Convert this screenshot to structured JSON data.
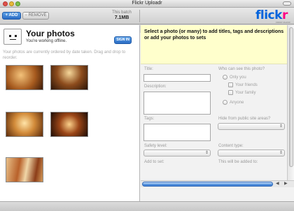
{
  "window": {
    "title": "Flickr Uploadr"
  },
  "toolbar": {
    "add_label": "+ ADD",
    "remove_label": "− REMOVE",
    "batch_label": "This batch",
    "batch_size": "7.1MB"
  },
  "brand": {
    "logo_part1": "flick",
    "logo_part2": "r",
    "logo_sub": "FROM YAHOO!",
    "color_blue": "#0063dc",
    "color_pink": "#ff0084"
  },
  "left_pane": {
    "title": "Your photos",
    "status": "You're working offline.",
    "signin_label": "SIGN IN",
    "order_note": "Your photos are currently ordered by date taken. Drag and drop to reorder.",
    "photos_count": 5
  },
  "right_pane": {
    "banner": "Select a photo (or many) to add titles, tags and descriptions or add your photos to sets",
    "title_label": "Title:",
    "description_label": "Description:",
    "tags_label": "Tags:",
    "safety_label": "Safety level:",
    "add_to_set_label": "Add to set:",
    "visibility_label": "Who can see this photo?",
    "visibility_options": [
      "Only you",
      "Your friends",
      "Your family",
      "Anyone"
    ],
    "hide_label": "Hide from public site areas?",
    "content_type_label": "Content type:",
    "will_be_added_label": "This will be added to:"
  }
}
